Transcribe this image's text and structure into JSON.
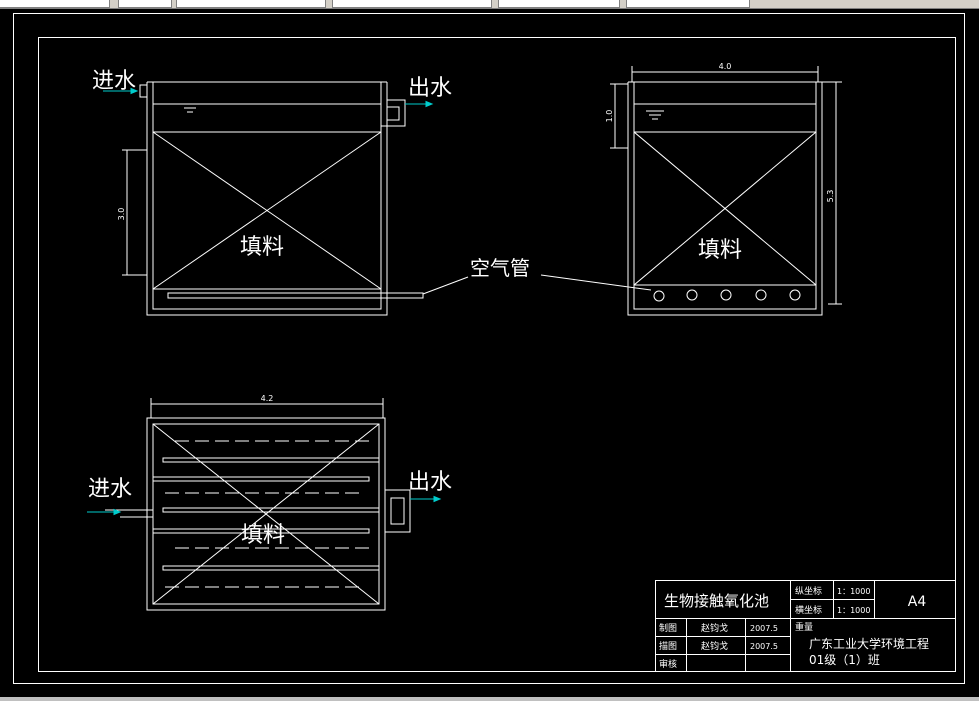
{
  "toolbar": {
    "style_icon": "layer-style-icon"
  },
  "drawing": {
    "front_view": {
      "inlet_label": "进水",
      "outlet_label": "出水",
      "fill_label": "填料",
      "dim_height": "3.0"
    },
    "air_pipe_label": "空气管",
    "side_view": {
      "fill_label": "填料",
      "dim_width": "4.0",
      "dim_top": "1.0",
      "dim_height": "5.3"
    },
    "plan_view": {
      "inlet_label": "进水",
      "outlet_label": "出水",
      "fill_label": "填料",
      "dim_width": "4.2"
    }
  },
  "title_block": {
    "title": "生物接触氧化池",
    "vertical_scale_label": "纵坐标",
    "vertical_scale_value": "1：1000",
    "horizontal_scale_label": "横坐标",
    "horizontal_scale_value": "1：1000",
    "weight_label": "重量",
    "sheet_size": "A4",
    "drawn_by_label": "制图",
    "drawn_by_name": "赵钧戈",
    "drawn_date": "2007.5",
    "traced_by_label": "描图",
    "traced_by_name": "赵钧戈",
    "traced_date": "2007.5",
    "reviewed_label": "审核",
    "school": "广东工业大学环境工程",
    "class_name": "01级（1）班"
  },
  "colors": {
    "background": "#000000",
    "lines": "#ffffff",
    "flow_arrow": "#00cccc"
  }
}
